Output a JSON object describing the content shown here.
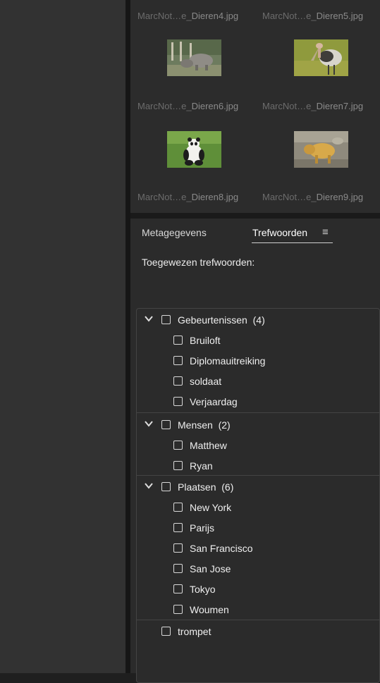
{
  "thumbnails": [
    {
      "label_base": "MarcNot…e_",
      "label_accent": "Dieren4.jpg",
      "has_image": false
    },
    {
      "label_base": "MarcNot…e_",
      "label_accent": "Dieren5.jpg",
      "has_image": false
    },
    {
      "label_base": "MarcNot…e_",
      "label_accent": "Dieren6.jpg",
      "has_image": true,
      "subject": "rhinoceros"
    },
    {
      "label_base": "MarcNot…e_",
      "label_accent": "Dieren7.jpg",
      "has_image": true,
      "subject": "marabou stork"
    },
    {
      "label_base": "MarcNot…e_",
      "label_accent": "Dieren8.jpg",
      "has_image": true,
      "subject": "panda"
    },
    {
      "label_base": "MarcNot…e_",
      "label_accent": "Dieren9.jpg",
      "has_image": true,
      "subject": "golden takin"
    }
  ],
  "tabs": {
    "metadata": "Metagegevens",
    "keywords": "Trefwoorden"
  },
  "assigned_keywords_label": "Toegewezen trefwoorden:",
  "keyword_groups": [
    {
      "name": "Gebeurtenissen",
      "count": "(4)",
      "items": [
        "Bruiloft",
        "Diplomauitreiking",
        "soldaat",
        "Verjaardag"
      ]
    },
    {
      "name": "Mensen",
      "count": "(2)",
      "items": [
        "Matthew",
        "Ryan"
      ]
    },
    {
      "name": "Plaatsen",
      "count": "(6)",
      "items": [
        "New York",
        "Parijs",
        "San Francisco",
        "San Jose",
        "Tokyo",
        "Woumen"
      ]
    }
  ],
  "loose_keyword": "trompet",
  "colors": {
    "panel": "#2b2b2b",
    "divider": "#161616",
    "text": "#e8e8e8",
    "muted": "#6c6c6c"
  }
}
